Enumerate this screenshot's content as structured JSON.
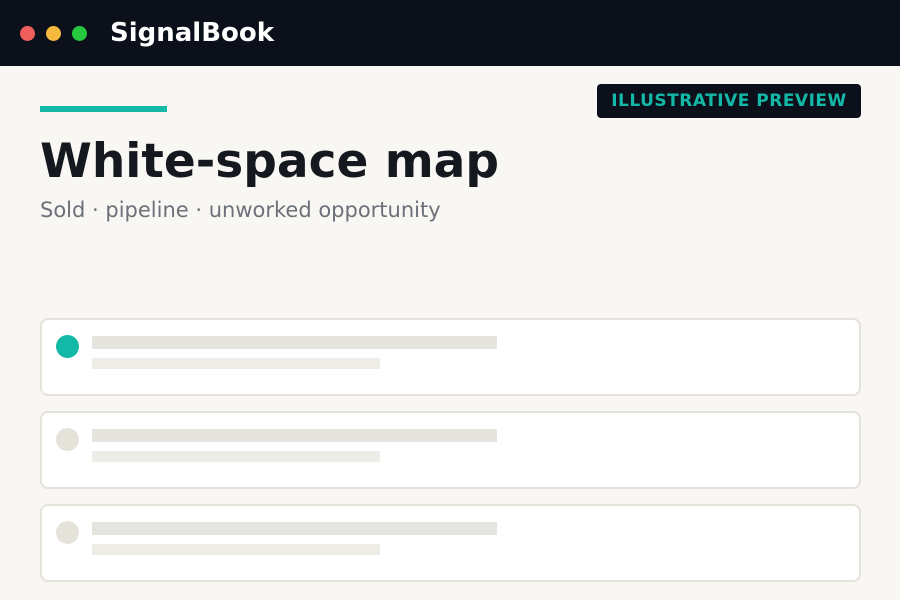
{
  "window": {
    "app_title": "SignalBook",
    "controls": [
      "close-dot",
      "minimize-dot",
      "maximize-dot"
    ]
  },
  "header": {
    "badge": "ILLUSTRATIVE PREVIEW",
    "title": "White-space map",
    "subtitle": "Sold · pipeline · unworked opportunity"
  },
  "list": {
    "items": [
      {
        "state": "active",
        "placeholder": true
      },
      {
        "state": "inactive",
        "placeholder": true
      },
      {
        "state": "inactive",
        "placeholder": true
      }
    ]
  },
  "colors": {
    "titlebar_bg": "#0b101a",
    "accent": "#14b8a6",
    "page_bg": "#f9f7f3",
    "close": "#ee5f5b",
    "minimize": "#f5b93d",
    "maximize": "#27c840",
    "skeleton": "#e6e4de"
  }
}
